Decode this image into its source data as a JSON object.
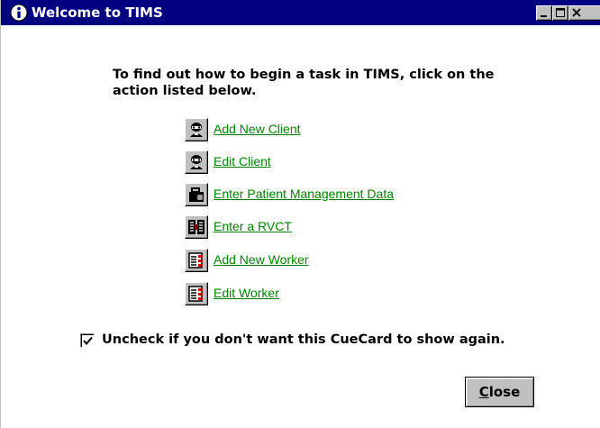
{
  "window": {
    "title": "Welcome to TIMS",
    "title_icon": "info-icon",
    "controls": [
      "minimize-icon",
      "maximize-icon",
      "close-icon"
    ],
    "titlebar_color": "#000080"
  },
  "intro": {
    "text": "To find out how to begin a task in TIMS, click on the action listed below."
  },
  "actions": [
    {
      "label": "Add New Client",
      "icon": "client-person-icon"
    },
    {
      "label": "Edit Client",
      "icon": "client-person-icon"
    },
    {
      "label": "Enter Patient Management Data",
      "icon": "patient-management-icon"
    },
    {
      "label": "Enter a RVCT",
      "icon": "rvct-form-icon"
    },
    {
      "label": "Add New Worker",
      "icon": "worker-list-icon"
    },
    {
      "label": "Edit Worker",
      "icon": "worker-list-icon"
    }
  ],
  "link_color": "#008000",
  "cuecard_option": {
    "label": "Uncheck if you don't want this CueCard to show again.",
    "checked": true
  },
  "close_button": {
    "accel": "C",
    "rest": "lose"
  }
}
